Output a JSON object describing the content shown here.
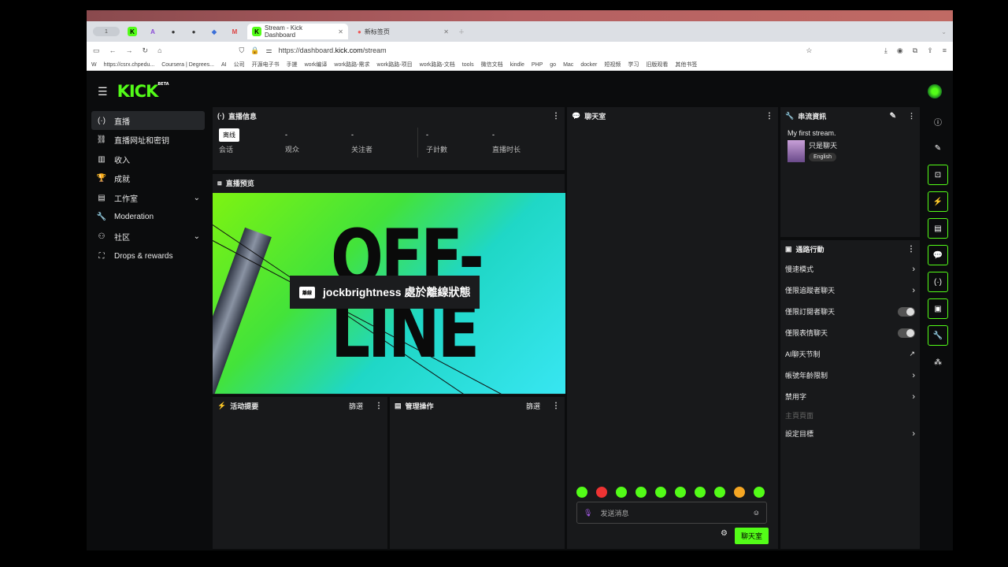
{
  "browser": {
    "apple": "",
    "tab_count": "1",
    "tab_active": "Stream - Kick Dashboard",
    "tab_other": "新标签页",
    "url_prefix": "https://dashboard.",
    "url_host": "kick.com",
    "url_path": "/stream",
    "bookmarks": [
      "W",
      "https://csrx.chpedu...",
      "Coursera | Degrees...",
      "AI",
      "公司",
      "开源电子书",
      "手搓",
      "work编译",
      "work路路-需求",
      "work路路-项目",
      "work路路-文档",
      "tools",
      "微信文档",
      "kindle",
      "PHP",
      "go",
      "Mac",
      "docker",
      "短视频",
      "学习",
      "旧版观看",
      "其他书签"
    ]
  },
  "colors": {
    "accent": "#53fc18",
    "bg": "#0b0c0d",
    "panel": "#18191b"
  },
  "sidebar": [
    {
      "label": "直播",
      "icon": "(·)"
    },
    {
      "label": "直播网址和密钥",
      "icon": "⛓"
    },
    {
      "label": "收入",
      "icon": "▥"
    },
    {
      "label": "成就",
      "icon": "🏆"
    },
    {
      "label": "工作室",
      "icon": "▤",
      "chev": "⌄"
    },
    {
      "label": "Moderation",
      "icon": "🔧"
    },
    {
      "label": "社区",
      "icon": "⚇",
      "chev": "⌄"
    },
    {
      "label": "Drops & rewards",
      "icon": "⛶"
    }
  ],
  "info": {
    "title": "直播信息",
    "badge": "离线",
    "cols": [
      {
        "value": "-",
        "label": "观众"
      },
      {
        "value": "-",
        "label": "关注者"
      },
      {
        "value": "-",
        "label": "子計數"
      },
      {
        "value": "-",
        "label": "直播时长"
      }
    ],
    "session_label": "会话"
  },
  "preview": {
    "title": "直播预览",
    "offline_text_1": "OFF-",
    "offline_text_2": "LINE",
    "overlay_tag": "離線",
    "overlay_text": "jockbrightness 處於離線狀態"
  },
  "activity": {
    "title": "活动提要",
    "filter": "篩選"
  },
  "modops": {
    "title": "管理操作",
    "filter": "篩選"
  },
  "chat": {
    "title": "聊天室",
    "placeholder": "发送消息",
    "send": "聊天室"
  },
  "streaminfo": {
    "title": "串流資訊",
    "stream_title": "My first stream.",
    "category": "只是聊天",
    "language": "English"
  },
  "modactions": {
    "title": "通路行動",
    "rows": [
      {
        "label": "慢速模式",
        "ctrl": "chevron"
      },
      {
        "label": "僅限追蹤者聊天",
        "ctrl": "chevron"
      },
      {
        "label": "僅限訂閱者聊天",
        "ctrl": "toggle"
      },
      {
        "label": "僅限表情聊天",
        "ctrl": "toggle"
      },
      {
        "label": "AI聊天节制",
        "ctrl": "ext"
      },
      {
        "label": "帳號年齡限制",
        "ctrl": "chevron"
      },
      {
        "label": "禁用字",
        "ctrl": "chevron"
      },
      {
        "label": "主頁頁面",
        "ctrl": "none"
      },
      {
        "label": "設定目標",
        "ctrl": "chevron"
      }
    ]
  }
}
